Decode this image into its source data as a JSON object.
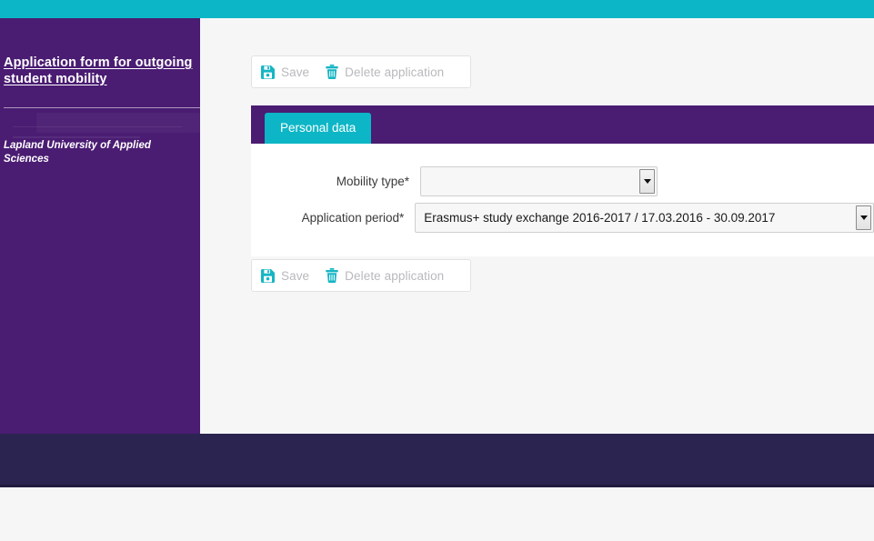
{
  "theme": {
    "teal": "#0cb6c6",
    "purple": "#4a1c72",
    "footer_navy": "#2b2450",
    "page_background": "#f6f6f7",
    "disabled_text": "#b9b9bd"
  },
  "sidebar": {
    "title": "Application form for outgoing student mobility",
    "organization": "Lapland University of Applied Sciences"
  },
  "toolbar": {
    "save_label": "Save",
    "delete_label": "Delete application",
    "save_icon": "floppy-disk-save-icon",
    "delete_icon": "trash-can-icon"
  },
  "panel": {
    "tabs": [
      {
        "label": "Personal data",
        "active": true
      }
    ],
    "fields": [
      {
        "label": "Mobility type*",
        "value": "",
        "placeholder": "",
        "control": "dropdown",
        "width": "short"
      },
      {
        "label": "Application period*",
        "value": "Erasmus+ study exchange 2016-2017 / 17.03.2016 - 30.09.2017",
        "placeholder": "",
        "control": "dropdown",
        "width": "long"
      }
    ]
  }
}
